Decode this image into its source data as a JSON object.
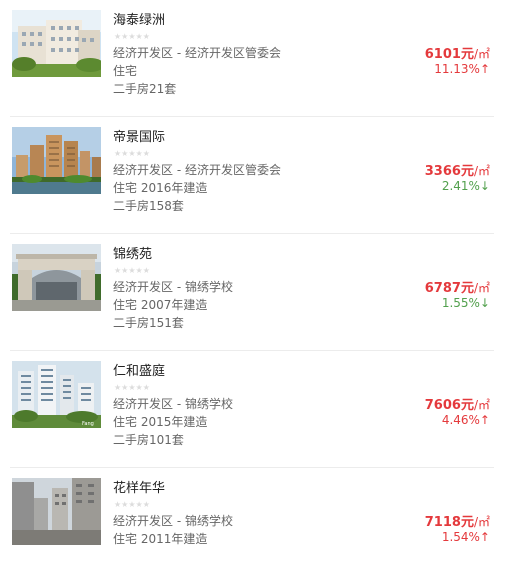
{
  "colors": {
    "price": "#e4393c",
    "up": "#e4393c",
    "down": "#52a04d",
    "stars": "#dcdcdc"
  },
  "listings": [
    {
      "name": "海泰绿洲",
      "stars": "★★★★★",
      "location": "经济开发区 - 经济开发区管委会",
      "type": "住宅",
      "secondhand": "二手房21套",
      "price": "6101元",
      "unit": "/㎡",
      "change": "11.13%↑",
      "direction": "up",
      "icon": "building-photo"
    },
    {
      "name": "帝景国际",
      "stars": "★★★★★",
      "location": "经济开发区 - 经济开发区管委会",
      "type": "住宅 2016年建造",
      "secondhand": "二手房158套",
      "price": "3366元",
      "unit": "/㎡",
      "change": "2.41%↓",
      "direction": "down",
      "icon": "building-photo"
    },
    {
      "name": "锦绣苑",
      "stars": "★★★★★",
      "location": "经济开发区 - 锦绣学校",
      "type": "住宅 2007年建造",
      "secondhand": "二手房151套",
      "price": "6787元",
      "unit": "/㎡",
      "change": "1.55%↓",
      "direction": "down",
      "icon": "building-photo"
    },
    {
      "name": "仁和盛庭",
      "stars": "★★★★★",
      "location": "经济开发区 - 锦绣学校",
      "type": "住宅 2015年建造",
      "secondhand": "二手房101套",
      "price": "7606元",
      "unit": "/㎡",
      "change": "4.46%↑",
      "direction": "up",
      "icon": "building-photo"
    },
    {
      "name": "花样年华",
      "stars": "★★★★★",
      "location": "经济开发区 - 锦绣学校",
      "type": "住宅 2011年建造",
      "secondhand": "",
      "price": "7118元",
      "unit": "/㎡",
      "change": "1.54%↑",
      "direction": "up",
      "icon": "building-photo"
    }
  ]
}
